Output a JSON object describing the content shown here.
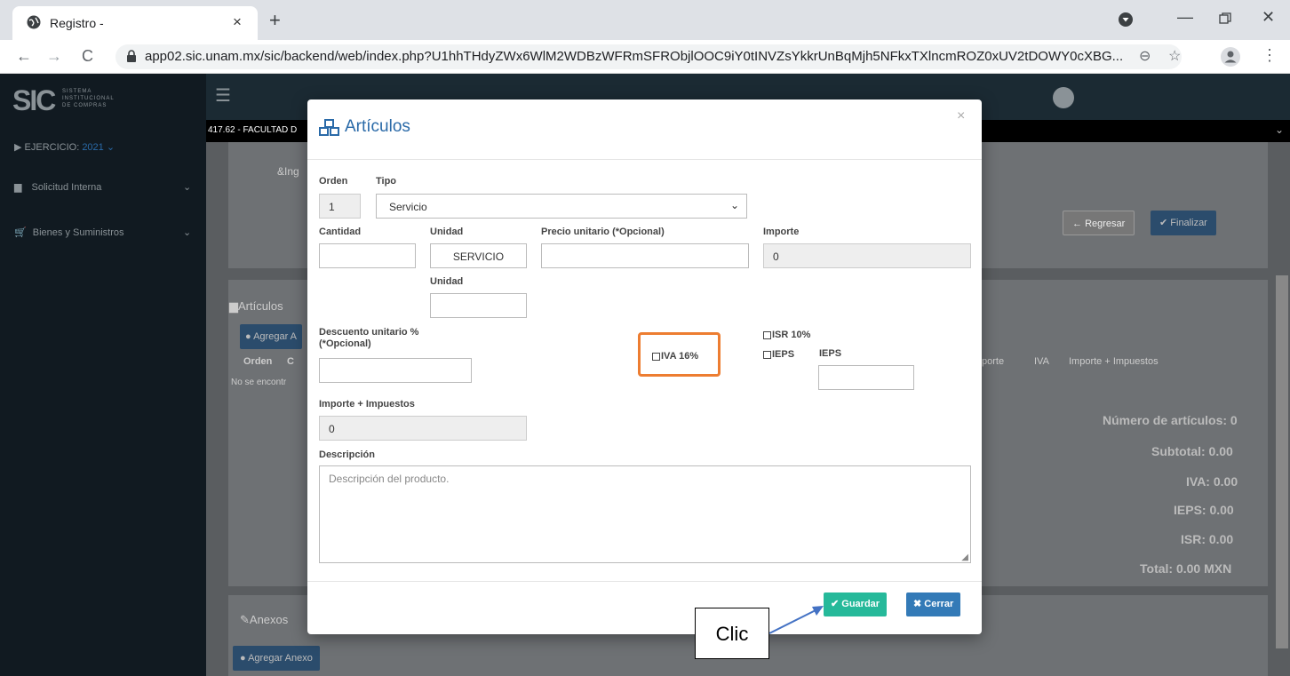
{
  "browser": {
    "tab_title": "Registro -",
    "url": "app02.sic.unam.mx/sic/backend/web/index.php?U1hhTHdyZWx6WlM2WDBzWFRmSFRObjlOOC9iY0tINVZsYkkrUnBqMjh5NFkxTXlncmROZ0xUV2tDOWY0cXBG..."
  },
  "app": {
    "logo_text": "SIC",
    "logo_sub": [
      "SISTEMA",
      "INSTITUCIONAL",
      "DE COMPRAS"
    ],
    "ejercicio_label": "EJERCICIO:",
    "ejercicio_value": "2021",
    "sidebar": [
      {
        "label": "Solicitud Interna"
      },
      {
        "label": "Bienes y Suministros"
      }
    ],
    "breadcrumb": "417.62 - FACULTAD D",
    "panel_title_partial": "&Ing",
    "regresar": "Regresar",
    "finalizar": "Finalizar",
    "articulos_section": "Artículos",
    "agregar_articulo": "Agregar A",
    "table_headers": {
      "orden": "Orden",
      "c": "C",
      "importe": "porte",
      "iva": "IVA",
      "importe_impuestos": "Importe + Impuestos"
    },
    "no_results": "No se encontr",
    "summary": {
      "numero": "Número de artículos: 0",
      "subtotal": "Subtotal: 0.00",
      "iva": "IVA: 0.00",
      "ieps": "IEPS: 0.00",
      "isr": "ISR: 0.00",
      "total": "Total: 0.00 MXN"
    },
    "anexos_section": "Anexos",
    "agregar_anexo": "Agregar Anexo"
  },
  "modal": {
    "title": "Artículos",
    "orden_label": "Orden",
    "orden_value": "1",
    "tipo_label": "Tipo",
    "tipo_value": "Servicio",
    "cantidad_label": "Cantidad",
    "cantidad_value": "",
    "unidad_label": "Unidad",
    "unidad_value": "SERVICIO",
    "precio_label": "Precio unitario (*Opcional)",
    "precio_value": "",
    "importe_label": "Importe",
    "importe_value": "0",
    "unidad2_label": "Unidad",
    "unidad2_value": "",
    "descuento_label_1": "Descuento unitario %",
    "descuento_label_2": "(*Opcional)",
    "descuento_value": "",
    "iva_label": "IVA 16%",
    "isr_label": "ISR 10%",
    "ieps_check_label": "IEPS",
    "ieps_label": "IEPS",
    "ieps_value": "",
    "importe_impuestos_label": "Importe + Impuestos",
    "importe_impuestos_value": "0",
    "descripcion_label": "Descripción",
    "descripcion_placeholder": "Descripción del producto.",
    "guardar": "Guardar",
    "cerrar": "Cerrar"
  },
  "annotation": {
    "callout": "Clic",
    "highlight_color": "#ed7d31",
    "arrow_color": "#4472c4"
  },
  "colors": {
    "guardar": "#26b99a",
    "cerrar": "#337ab7",
    "title": "#2a6aa8"
  }
}
